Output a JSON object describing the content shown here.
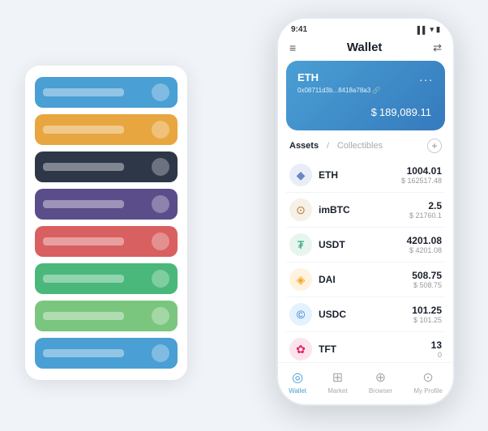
{
  "scene": {
    "cardStack": {
      "cards": [
        {
          "color": "card-blue",
          "label": ""
        },
        {
          "color": "card-orange",
          "label": ""
        },
        {
          "color": "card-dark",
          "label": ""
        },
        {
          "color": "card-purple",
          "label": ""
        },
        {
          "color": "card-red",
          "label": ""
        },
        {
          "color": "card-green",
          "label": ""
        },
        {
          "color": "card-light-green",
          "label": ""
        },
        {
          "color": "card-sky",
          "label": ""
        }
      ]
    },
    "phone": {
      "statusBar": {
        "time": "9:41",
        "icons": "▌▌ ▾ 🔋"
      },
      "header": {
        "menuIcon": "≡",
        "title": "Wallet",
        "expandIcon": "⇄"
      },
      "ethCard": {
        "title": "ETH",
        "dots": "...",
        "address": "0x08711d3b...8418a78a3 🔗",
        "currencySymbol": "$",
        "amount": "189,089.11"
      },
      "assetsSection": {
        "tabActive": "Assets",
        "separator": "/",
        "tabInactive": "Collectibles",
        "addIcon": "+"
      },
      "assets": [
        {
          "name": "ETH",
          "icon": "◆",
          "iconBg": "#e8edf8",
          "iconColor": "#6c85c4",
          "amount": "1004.01",
          "usd": "$ 162517.48"
        },
        {
          "name": "imBTC",
          "icon": "⊙",
          "iconBg": "#f5f0e8",
          "iconColor": "#c07830",
          "amount": "2.5",
          "usd": "$ 21760.1"
        },
        {
          "name": "USDT",
          "icon": "₮",
          "iconBg": "#e8f5ee",
          "iconColor": "#26a17b",
          "amount": "4201.08",
          "usd": "$ 4201.08"
        },
        {
          "name": "DAI",
          "icon": "◈",
          "iconBg": "#fff3e0",
          "iconColor": "#f5a623",
          "amount": "508.75",
          "usd": "$ 508.75"
        },
        {
          "name": "USDC",
          "icon": "©",
          "iconBg": "#e3f2fd",
          "iconColor": "#2775ca",
          "amount": "101.25",
          "usd": "$ 101.25"
        },
        {
          "name": "TFT",
          "icon": "✿",
          "iconBg": "#fce4ec",
          "iconColor": "#e91e63",
          "amount": "13",
          "usd": "0"
        }
      ],
      "bottomNav": [
        {
          "icon": "◎",
          "label": "Wallet",
          "active": true
        },
        {
          "icon": "⊞",
          "label": "Market",
          "active": false
        },
        {
          "icon": "⊕",
          "label": "Browser",
          "active": false
        },
        {
          "icon": "⊙",
          "label": "My Profile",
          "active": false
        }
      ]
    }
  }
}
